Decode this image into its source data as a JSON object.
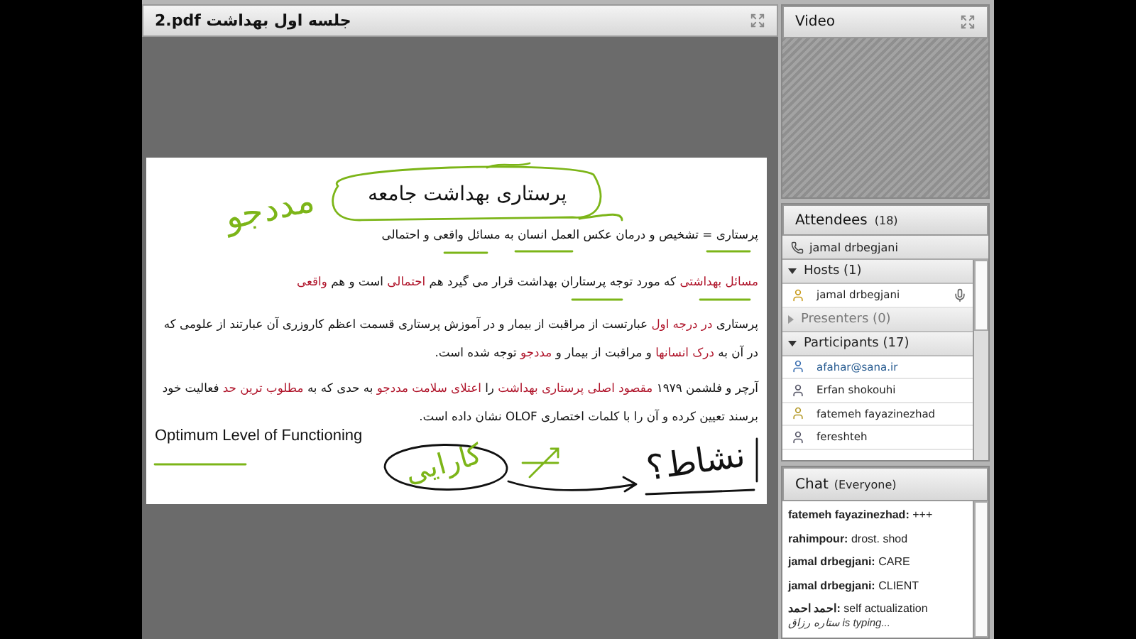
{
  "document_pod": {
    "title": "2.pdf جلسه اول بهداشت",
    "slide": {
      "title": "پرستاری بهداشت جامعه",
      "paragraphs": [
        {
          "kind": "rtl",
          "segments": [
            {
              "text": "پرستاری = تشخیص و درمان عکس العمل انسان به مسائل واقعی و احتمالی",
              "highlight": false
            }
          ]
        },
        {
          "kind": "rtl",
          "segments": [
            {
              "text": "مسائل بهداشتی",
              "highlight": true
            },
            {
              "text": " که مورد توجه پرستاران بهداشت قرار می گیرد هم ",
              "highlight": false
            },
            {
              "text": "احتمالی",
              "highlight": true
            },
            {
              "text": " است و هم ",
              "highlight": false
            },
            {
              "text": "واقعی",
              "highlight": true
            }
          ]
        },
        {
          "kind": "rtl",
          "segments": [
            {
              "text": "پرستاری ",
              "highlight": false
            },
            {
              "text": "در درجه اول",
              "highlight": true
            },
            {
              "text": " عبارتست از مراقبت از بیمار و در آموزش پرستاری قسمت اعظم کاروزری آن عبارتند از علومی که در آن به ",
              "highlight": false
            },
            {
              "text": "درک انسانها",
              "highlight": true
            },
            {
              "text": " و مراقبت از بیمار و ",
              "highlight": false
            },
            {
              "text": "مددجو",
              "highlight": true
            },
            {
              "text": " توجه شده است.",
              "highlight": false
            }
          ]
        },
        {
          "kind": "rtl",
          "segments": [
            {
              "text": "آرچر و فلشمن ۱۹۷۹ ",
              "highlight": false
            },
            {
              "text": "مقصود اصلی پرستاری بهداشت",
              "highlight": true
            },
            {
              "text": " را ",
              "highlight": false
            },
            {
              "text": "اعتلای سلامت مددجو",
              "highlight": true
            },
            {
              "text": " به حدی که به ",
              "highlight": false
            },
            {
              "text": "مطلوب ترین حد",
              "highlight": true
            },
            {
              "text": " فعالیت خود برسند تعیین کرده و آن را با کلمات اختصاری OLOF نشان داده است.",
              "highlight": false
            }
          ]
        },
        {
          "kind": "ltr",
          "segments": [
            {
              "text": "Optimum Level of Functioning",
              "highlight": false
            }
          ]
        }
      ],
      "handwritten_notes": [
        {
          "text": "مددجو",
          "color": "#7cb518"
        },
        {
          "text": "کارایی",
          "color": "#7cb518"
        },
        {
          "text": "نشاط؟",
          "color": "#111111"
        }
      ]
    }
  },
  "video_pod": {
    "title": "Video"
  },
  "attendees_pod": {
    "title": "Attendees",
    "count": "(18)",
    "caller": "jamal drbegjani",
    "groups": [
      {
        "label": "Hosts (1)",
        "expanded": true,
        "children": [
          {
            "name": "jamal drbegjani",
            "kind": "host"
          }
        ]
      },
      {
        "label": "Presenters (0)",
        "expanded": false
      },
      {
        "label": "Participants (17)",
        "expanded": true,
        "children": [
          {
            "name": "afahar@sana.ir",
            "kind": "self"
          },
          {
            "name": "Erfan shokouhi",
            "kind": "participant"
          },
          {
            "name": "fatemeh fayazinezhad",
            "kind": "guest"
          },
          {
            "name": "fereshteh",
            "kind": "participant"
          }
        ]
      }
    ]
  },
  "chat_pod": {
    "title": "Chat",
    "scope": "(Everyone)",
    "messages": [
      {
        "kind": "message",
        "sender": "fatemeh fayazinezhad:",
        "text": "+++"
      },
      {
        "kind": "message",
        "sender": "rahimpour:",
        "text": "drost. shod"
      },
      {
        "kind": "message",
        "sender": "jamal drbegjani:",
        "text": "CARE"
      },
      {
        "kind": "message",
        "sender": "jamal drbegjani:",
        "text": "CLIENT"
      },
      {
        "kind": "message",
        "sender": "احمد احمد:",
        "text": "self actualization"
      },
      {
        "kind": "typing",
        "sender": "ستاره رزاق",
        "text": "is typing..."
      }
    ]
  }
}
